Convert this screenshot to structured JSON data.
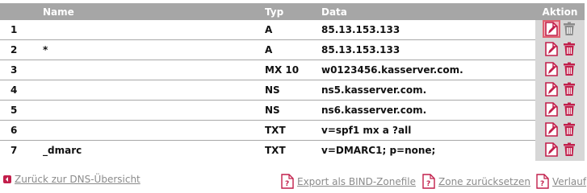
{
  "table": {
    "headers": {
      "num": "",
      "name": "Name",
      "type": "Typ",
      "data": "Data",
      "action": "Aktion"
    },
    "rows": [
      {
        "num": "1",
        "name": "",
        "type": "A",
        "data": "85.13.153.133"
      },
      {
        "num": "2",
        "name": "*",
        "type": "A",
        "data": "85.13.153.133"
      },
      {
        "num": "3",
        "name": "",
        "type": "MX 10",
        "data": "w0123456.kasserver.com."
      },
      {
        "num": "4",
        "name": "",
        "type": "NS",
        "data": "ns5.kasserver.com."
      },
      {
        "num": "5",
        "name": "",
        "type": "NS",
        "data": "ns6.kasserver.com."
      },
      {
        "num": "6",
        "name": "",
        "type": "TXT",
        "data": "v=spf1 mx a ?all"
      },
      {
        "num": "7",
        "name": "_dmarc",
        "type": "TXT",
        "data": "v=DMARC1; p=none;"
      }
    ]
  },
  "footer": {
    "back": "Zurück zur DNS-Übersicht",
    "export": "Export als BIND-Zonefile",
    "reset": "Zone zurücksetzen",
    "history": "Verlauf"
  },
  "icons": {
    "edit": "edit-document-icon",
    "delete": "trash-icon",
    "back": "back-arrow-icon",
    "doc": "question-document-icon"
  },
  "colors": {
    "header_bg": "#a6a6a6",
    "action_bg": "#d7d7d7",
    "accent": "#c21f4b",
    "link": "#8b8b8b"
  }
}
